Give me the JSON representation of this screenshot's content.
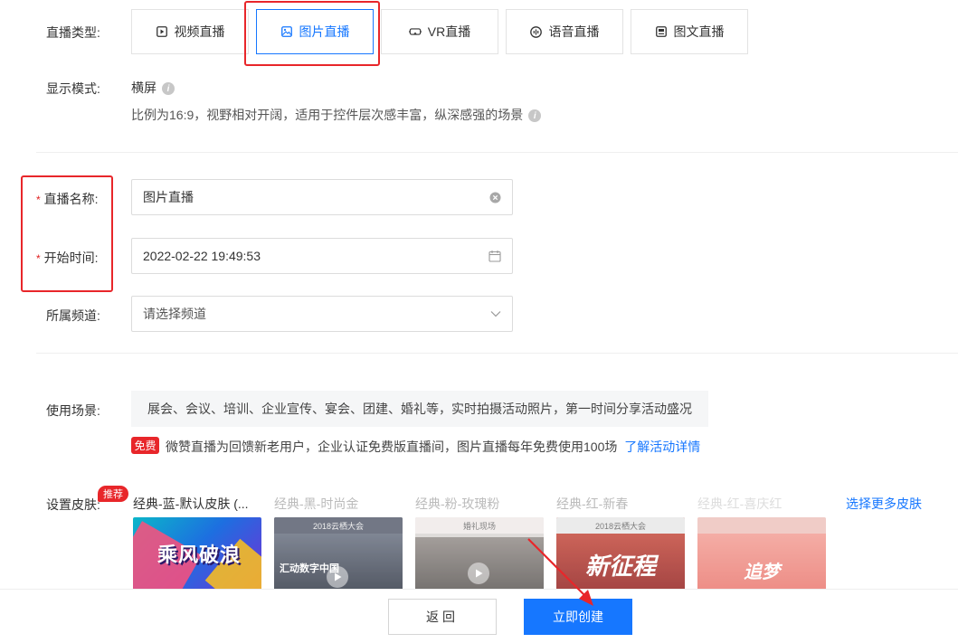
{
  "live_type": {
    "label": "直播类型:",
    "options": [
      {
        "label": "视频直播",
        "icon": "video-play-icon"
      },
      {
        "label": "图片直播",
        "icon": "image-icon",
        "active": true
      },
      {
        "label": "VR直播",
        "icon": "vr-headset-icon"
      },
      {
        "label": "语音直播",
        "icon": "microphone-icon"
      },
      {
        "label": "图文直播",
        "icon": "image-text-icon"
      }
    ]
  },
  "display_mode": {
    "label": "显示模式:",
    "value": "横屏",
    "description": "比例为16:9，视野相对开阔，适用于控件层次感丰富，纵深感强的场景"
  },
  "live_name": {
    "label": "直播名称:",
    "required_mark": "*",
    "value": "图片直播"
  },
  "start_time": {
    "label": "开始时间:",
    "required_mark": "*",
    "value": "2022-02-22 19:49:53"
  },
  "channel": {
    "label": "所属频道:",
    "placeholder": "请选择频道"
  },
  "scene": {
    "label": "使用场景:",
    "text": "展会、会议、培训、企业宣传、宴会、团建、婚礼等，实时拍摄活动照片，第一时间分享活动盛况"
  },
  "promo": {
    "badge": "免费",
    "text": "微赞直播为回馈新老用户，企业认证免费版直播间，图片直播每年免费使用100场",
    "link": "了解活动详情"
  },
  "skins": {
    "label": "设置皮肤:",
    "hot_badge": "推荐",
    "more_link": "选择更多皮肤",
    "items": [
      {
        "title": "经典-蓝-默认皮肤 (...",
        "thumb_text": "乘风破浪",
        "selected": true
      },
      {
        "title": "经典-黑-时尚金",
        "thumb_text": "汇动数字中国",
        "header": "2018云栖大会"
      },
      {
        "title": "经典-粉-玫瑰粉",
        "thumb_text": "",
        "header": "婚礼现场"
      },
      {
        "title": "经典-红-新春",
        "thumb_text": "新征程",
        "header": "2018云栖大会"
      },
      {
        "title": "经典-红-喜庆红",
        "thumb_text": "追梦",
        "header": ""
      }
    ]
  },
  "footer": {
    "back_label": "返回",
    "create_label": "立即创建"
  },
  "colors": {
    "accent": "#1677ff",
    "highlight": "#e8262a"
  }
}
